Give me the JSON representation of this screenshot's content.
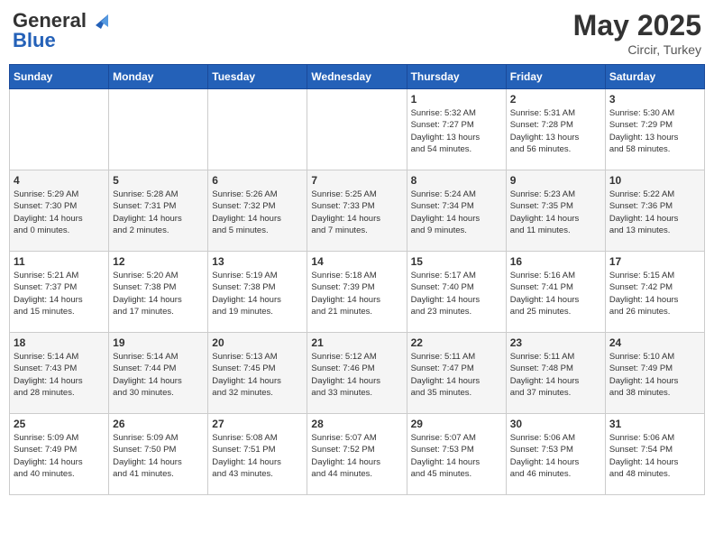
{
  "header": {
    "logo_general": "General",
    "logo_blue": "Blue",
    "month": "May 2025",
    "location": "Circir, Turkey"
  },
  "days_of_week": [
    "Sunday",
    "Monday",
    "Tuesday",
    "Wednesday",
    "Thursday",
    "Friday",
    "Saturday"
  ],
  "weeks": [
    [
      {
        "day": "",
        "info": ""
      },
      {
        "day": "",
        "info": ""
      },
      {
        "day": "",
        "info": ""
      },
      {
        "day": "",
        "info": ""
      },
      {
        "day": "1",
        "info": "Sunrise: 5:32 AM\nSunset: 7:27 PM\nDaylight: 13 hours\nand 54 minutes."
      },
      {
        "day": "2",
        "info": "Sunrise: 5:31 AM\nSunset: 7:28 PM\nDaylight: 13 hours\nand 56 minutes."
      },
      {
        "day": "3",
        "info": "Sunrise: 5:30 AM\nSunset: 7:29 PM\nDaylight: 13 hours\nand 58 minutes."
      }
    ],
    [
      {
        "day": "4",
        "info": "Sunrise: 5:29 AM\nSunset: 7:30 PM\nDaylight: 14 hours\nand 0 minutes."
      },
      {
        "day": "5",
        "info": "Sunrise: 5:28 AM\nSunset: 7:31 PM\nDaylight: 14 hours\nand 2 minutes."
      },
      {
        "day": "6",
        "info": "Sunrise: 5:26 AM\nSunset: 7:32 PM\nDaylight: 14 hours\nand 5 minutes."
      },
      {
        "day": "7",
        "info": "Sunrise: 5:25 AM\nSunset: 7:33 PM\nDaylight: 14 hours\nand 7 minutes."
      },
      {
        "day": "8",
        "info": "Sunrise: 5:24 AM\nSunset: 7:34 PM\nDaylight: 14 hours\nand 9 minutes."
      },
      {
        "day": "9",
        "info": "Sunrise: 5:23 AM\nSunset: 7:35 PM\nDaylight: 14 hours\nand 11 minutes."
      },
      {
        "day": "10",
        "info": "Sunrise: 5:22 AM\nSunset: 7:36 PM\nDaylight: 14 hours\nand 13 minutes."
      }
    ],
    [
      {
        "day": "11",
        "info": "Sunrise: 5:21 AM\nSunset: 7:37 PM\nDaylight: 14 hours\nand 15 minutes."
      },
      {
        "day": "12",
        "info": "Sunrise: 5:20 AM\nSunset: 7:38 PM\nDaylight: 14 hours\nand 17 minutes."
      },
      {
        "day": "13",
        "info": "Sunrise: 5:19 AM\nSunset: 7:38 PM\nDaylight: 14 hours\nand 19 minutes."
      },
      {
        "day": "14",
        "info": "Sunrise: 5:18 AM\nSunset: 7:39 PM\nDaylight: 14 hours\nand 21 minutes."
      },
      {
        "day": "15",
        "info": "Sunrise: 5:17 AM\nSunset: 7:40 PM\nDaylight: 14 hours\nand 23 minutes."
      },
      {
        "day": "16",
        "info": "Sunrise: 5:16 AM\nSunset: 7:41 PM\nDaylight: 14 hours\nand 25 minutes."
      },
      {
        "day": "17",
        "info": "Sunrise: 5:15 AM\nSunset: 7:42 PM\nDaylight: 14 hours\nand 26 minutes."
      }
    ],
    [
      {
        "day": "18",
        "info": "Sunrise: 5:14 AM\nSunset: 7:43 PM\nDaylight: 14 hours\nand 28 minutes."
      },
      {
        "day": "19",
        "info": "Sunrise: 5:14 AM\nSunset: 7:44 PM\nDaylight: 14 hours\nand 30 minutes."
      },
      {
        "day": "20",
        "info": "Sunrise: 5:13 AM\nSunset: 7:45 PM\nDaylight: 14 hours\nand 32 minutes."
      },
      {
        "day": "21",
        "info": "Sunrise: 5:12 AM\nSunset: 7:46 PM\nDaylight: 14 hours\nand 33 minutes."
      },
      {
        "day": "22",
        "info": "Sunrise: 5:11 AM\nSunset: 7:47 PM\nDaylight: 14 hours\nand 35 minutes."
      },
      {
        "day": "23",
        "info": "Sunrise: 5:11 AM\nSunset: 7:48 PM\nDaylight: 14 hours\nand 37 minutes."
      },
      {
        "day": "24",
        "info": "Sunrise: 5:10 AM\nSunset: 7:49 PM\nDaylight: 14 hours\nand 38 minutes."
      }
    ],
    [
      {
        "day": "25",
        "info": "Sunrise: 5:09 AM\nSunset: 7:49 PM\nDaylight: 14 hours\nand 40 minutes."
      },
      {
        "day": "26",
        "info": "Sunrise: 5:09 AM\nSunset: 7:50 PM\nDaylight: 14 hours\nand 41 minutes."
      },
      {
        "day": "27",
        "info": "Sunrise: 5:08 AM\nSunset: 7:51 PM\nDaylight: 14 hours\nand 43 minutes."
      },
      {
        "day": "28",
        "info": "Sunrise: 5:07 AM\nSunset: 7:52 PM\nDaylight: 14 hours\nand 44 minutes."
      },
      {
        "day": "29",
        "info": "Sunrise: 5:07 AM\nSunset: 7:53 PM\nDaylight: 14 hours\nand 45 minutes."
      },
      {
        "day": "30",
        "info": "Sunrise: 5:06 AM\nSunset: 7:53 PM\nDaylight: 14 hours\nand 46 minutes."
      },
      {
        "day": "31",
        "info": "Sunrise: 5:06 AM\nSunset: 7:54 PM\nDaylight: 14 hours\nand 48 minutes."
      }
    ]
  ]
}
